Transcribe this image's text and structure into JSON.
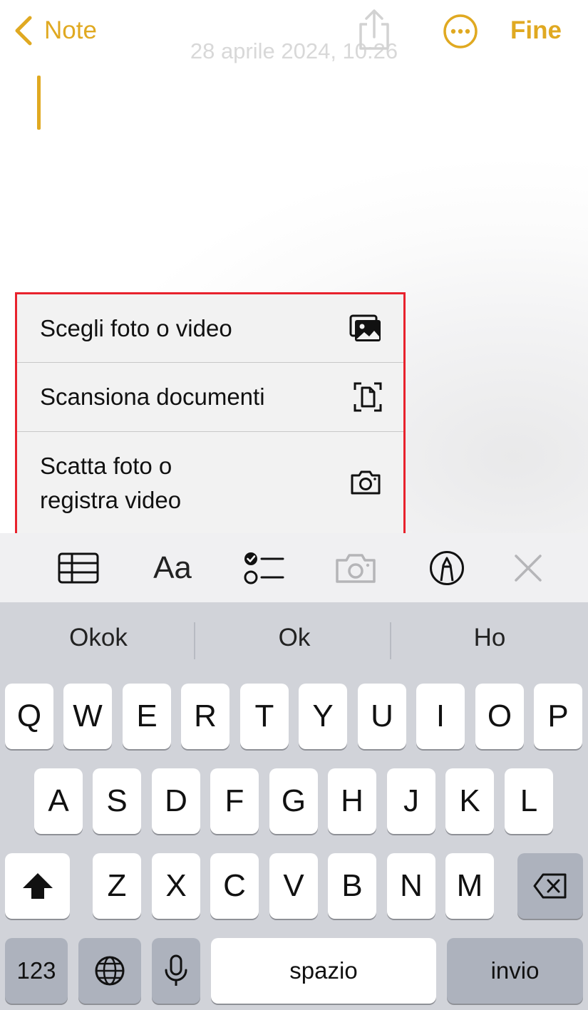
{
  "nav": {
    "back_label": "Note",
    "done_label": "Fine",
    "date": "28 aprile 2024, 10:26"
  },
  "menu": {
    "items": [
      {
        "label": "Scegli foto o video",
        "icon": "photo-library-icon"
      },
      {
        "label": "Scansiona documenti",
        "icon": "document-scan-icon"
      },
      {
        "label_line1": "Scatta foto o",
        "label_line2": "registra video",
        "icon": "camera-icon"
      }
    ]
  },
  "toolbar": {
    "format_label": "Aa",
    "icons": [
      "table-icon",
      "format-text-icon",
      "checklist-icon",
      "camera-icon",
      "markup-pen-icon",
      "close-icon"
    ]
  },
  "keyboard": {
    "suggestions": [
      "Okok",
      "Ok",
      "Ho"
    ],
    "row1": [
      "Q",
      "W",
      "E",
      "R",
      "T",
      "Y",
      "U",
      "I",
      "O",
      "P"
    ],
    "row2": [
      "A",
      "S",
      "D",
      "F",
      "G",
      "H",
      "J",
      "K",
      "L"
    ],
    "row3": [
      "Z",
      "X",
      "C",
      "V",
      "B",
      "N",
      "M"
    ],
    "numbers_label": "123",
    "space_label": "spazio",
    "return_label": "invio"
  },
  "colors": {
    "accent": "#E0A921",
    "highlight_border": "#E8222D"
  }
}
